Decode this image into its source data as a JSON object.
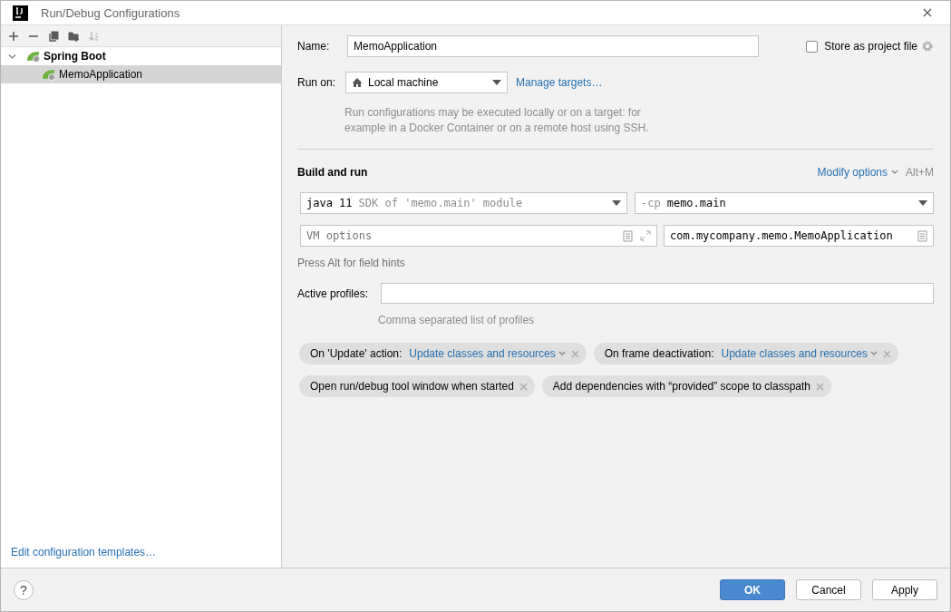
{
  "window": {
    "title": "Run/Debug Configurations"
  },
  "toolbar": [
    {
      "kind": "add",
      "disabled": false
    },
    {
      "kind": "remove",
      "disabled": false
    },
    {
      "kind": "copy",
      "disabled": false
    },
    {
      "kind": "folder",
      "disabled": false
    },
    {
      "kind": "sort",
      "disabled": true
    }
  ],
  "tree": [
    {
      "label": "Spring Boot",
      "expanded": true,
      "selected": false,
      "children": [
        {
          "label": "MemoApplication",
          "selected": true
        }
      ]
    }
  ],
  "edit_templates_link": "Edit configuration templates…",
  "name": {
    "label": "Name:",
    "value": "MemoApplication"
  },
  "store_as_project_file": {
    "label": "Store as project file",
    "checked": false
  },
  "run_on": {
    "label": "Run on:",
    "value": "Local machine",
    "link": "Manage targets…",
    "hint": "Run configurations may be executed locally or on a target: for example in a Docker Container or on a remote host using SSH."
  },
  "build_and_run": {
    "title": "Build and run",
    "modify_options": "Modify options",
    "shortcut": "Alt+M",
    "jre": {
      "value": "java 11",
      "hint": "SDK of 'memo.main' module"
    },
    "classpath": {
      "prefix": "-cp",
      "value": "memo.main"
    },
    "vm_options": {
      "placeholder": "VM options"
    },
    "main_class": {
      "value": "com.mycompany.memo.MemoApplication"
    },
    "note": "Press Alt for field hints"
  },
  "active_profiles": {
    "label": "Active profiles:",
    "hint": "Comma separated list of profiles"
  },
  "option_chips": [
    {
      "label": "On 'Update' action:",
      "value": "Update classes and resources"
    },
    {
      "label": "On frame deactivation:",
      "value": "Update classes and resources"
    },
    {
      "label": "Open run/debug tool window when started"
    },
    {
      "label": "Add dependencies with “provided” scope to classpath"
    }
  ],
  "help_button": "?",
  "buttons": [
    {
      "label": "OK",
      "default": true
    },
    {
      "label": "Cancel",
      "default": false
    },
    {
      "label": "Apply",
      "default": false
    }
  ]
}
